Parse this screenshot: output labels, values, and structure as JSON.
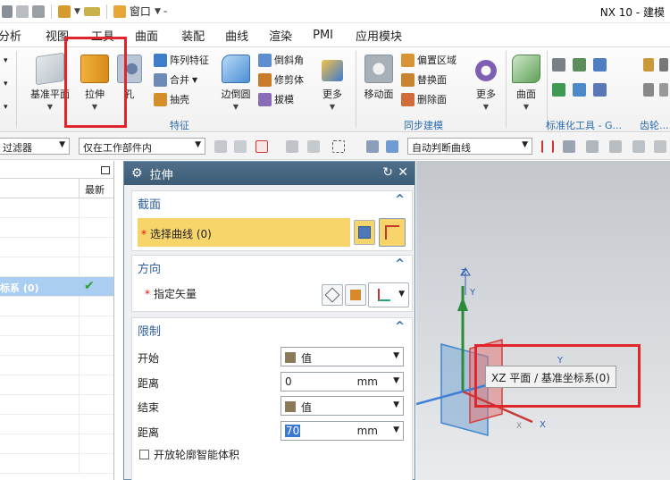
{
  "app": {
    "title": "NX 10 - 建模",
    "window_menu": "窗口"
  },
  "tabs": [
    "分析",
    "视图",
    "工具",
    "曲面",
    "装配",
    "曲线",
    "渲染",
    "PMI",
    "应用模块"
  ],
  "ribbon": {
    "datum_plane": "基准平面",
    "extrude": "拉伸",
    "hole": "孔",
    "pattern_feature": "阵列特征",
    "combine": "合并",
    "shell": "抽壳",
    "edge_blend": "边倒圆",
    "chamfer": "倒斜角",
    "trim_body": "修剪体",
    "draft": "拔模",
    "more1": "更多",
    "move_face": "移动面",
    "offset_region": "偏置区域",
    "replace_face": "替换面",
    "delete_face": "删除面",
    "more2": "更多",
    "surface": "曲面",
    "group_feature": "特征",
    "group_sync": "同步建模",
    "group_std": "标准化工具 - G...",
    "group_gear": "齿轮..."
  },
  "selection_bar": {
    "filter": "过滤器",
    "scope": "仅在工作部件内",
    "curve_rule": "自动判断曲线"
  },
  "navigator": {
    "col_latest": "最新",
    "selected_row": "标系 (0)"
  },
  "dialog": {
    "title": "拉伸",
    "section1": "截面",
    "select_curve": "选择曲线 (0)",
    "section2": "方向",
    "specify_vector": "指定矢量",
    "section3": "限制",
    "start_label": "开始",
    "start_value": "值",
    "distance1_label": "距离",
    "distance1_value": "0",
    "distance1_unit": "mm",
    "end_label": "结束",
    "end_value": "值",
    "distance2_label": "距离",
    "distance2_value": "70",
    "distance2_unit": "mm",
    "open_profile": "开放轮廓智能体积"
  },
  "viewport": {
    "tooltip": "XZ 平面 / 基准坐标系(0)",
    "axis_z": "Z",
    "axis_y": "Y",
    "axis_x": "X",
    "axis_z2": "Y",
    "axis_y2": "Y",
    "axis_x2": "X"
  }
}
